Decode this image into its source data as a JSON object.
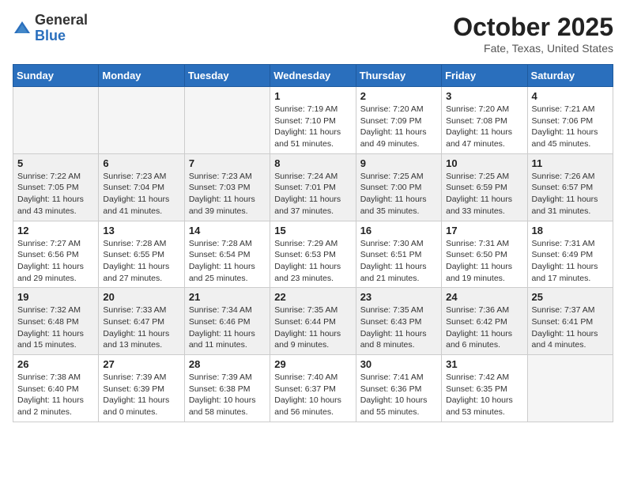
{
  "header": {
    "logo_general": "General",
    "logo_blue": "Blue",
    "month_title": "October 2025",
    "location": "Fate, Texas, United States"
  },
  "weekdays": [
    "Sunday",
    "Monday",
    "Tuesday",
    "Wednesday",
    "Thursday",
    "Friday",
    "Saturday"
  ],
  "weeks": [
    [
      {
        "day": "",
        "sunrise": "",
        "sunset": "",
        "daylight": "",
        "empty": true
      },
      {
        "day": "",
        "sunrise": "",
        "sunset": "",
        "daylight": "",
        "empty": true
      },
      {
        "day": "",
        "sunrise": "",
        "sunset": "",
        "daylight": "",
        "empty": true
      },
      {
        "day": "1",
        "sunrise": "Sunrise: 7:19 AM",
        "sunset": "Sunset: 7:10 PM",
        "daylight": "Daylight: 11 hours and 51 minutes."
      },
      {
        "day": "2",
        "sunrise": "Sunrise: 7:20 AM",
        "sunset": "Sunset: 7:09 PM",
        "daylight": "Daylight: 11 hours and 49 minutes."
      },
      {
        "day": "3",
        "sunrise": "Sunrise: 7:20 AM",
        "sunset": "Sunset: 7:08 PM",
        "daylight": "Daylight: 11 hours and 47 minutes."
      },
      {
        "day": "4",
        "sunrise": "Sunrise: 7:21 AM",
        "sunset": "Sunset: 7:06 PM",
        "daylight": "Daylight: 11 hours and 45 minutes."
      }
    ],
    [
      {
        "day": "5",
        "sunrise": "Sunrise: 7:22 AM",
        "sunset": "Sunset: 7:05 PM",
        "daylight": "Daylight: 11 hours and 43 minutes."
      },
      {
        "day": "6",
        "sunrise": "Sunrise: 7:23 AM",
        "sunset": "Sunset: 7:04 PM",
        "daylight": "Daylight: 11 hours and 41 minutes."
      },
      {
        "day": "7",
        "sunrise": "Sunrise: 7:23 AM",
        "sunset": "Sunset: 7:03 PM",
        "daylight": "Daylight: 11 hours and 39 minutes."
      },
      {
        "day": "8",
        "sunrise": "Sunrise: 7:24 AM",
        "sunset": "Sunset: 7:01 PM",
        "daylight": "Daylight: 11 hours and 37 minutes."
      },
      {
        "day": "9",
        "sunrise": "Sunrise: 7:25 AM",
        "sunset": "Sunset: 7:00 PM",
        "daylight": "Daylight: 11 hours and 35 minutes."
      },
      {
        "day": "10",
        "sunrise": "Sunrise: 7:25 AM",
        "sunset": "Sunset: 6:59 PM",
        "daylight": "Daylight: 11 hours and 33 minutes."
      },
      {
        "day": "11",
        "sunrise": "Sunrise: 7:26 AM",
        "sunset": "Sunset: 6:57 PM",
        "daylight": "Daylight: 11 hours and 31 minutes."
      }
    ],
    [
      {
        "day": "12",
        "sunrise": "Sunrise: 7:27 AM",
        "sunset": "Sunset: 6:56 PM",
        "daylight": "Daylight: 11 hours and 29 minutes."
      },
      {
        "day": "13",
        "sunrise": "Sunrise: 7:28 AM",
        "sunset": "Sunset: 6:55 PM",
        "daylight": "Daylight: 11 hours and 27 minutes."
      },
      {
        "day": "14",
        "sunrise": "Sunrise: 7:28 AM",
        "sunset": "Sunset: 6:54 PM",
        "daylight": "Daylight: 11 hours and 25 minutes."
      },
      {
        "day": "15",
        "sunrise": "Sunrise: 7:29 AM",
        "sunset": "Sunset: 6:53 PM",
        "daylight": "Daylight: 11 hours and 23 minutes."
      },
      {
        "day": "16",
        "sunrise": "Sunrise: 7:30 AM",
        "sunset": "Sunset: 6:51 PM",
        "daylight": "Daylight: 11 hours and 21 minutes."
      },
      {
        "day": "17",
        "sunrise": "Sunrise: 7:31 AM",
        "sunset": "Sunset: 6:50 PM",
        "daylight": "Daylight: 11 hours and 19 minutes."
      },
      {
        "day": "18",
        "sunrise": "Sunrise: 7:31 AM",
        "sunset": "Sunset: 6:49 PM",
        "daylight": "Daylight: 11 hours and 17 minutes."
      }
    ],
    [
      {
        "day": "19",
        "sunrise": "Sunrise: 7:32 AM",
        "sunset": "Sunset: 6:48 PM",
        "daylight": "Daylight: 11 hours and 15 minutes."
      },
      {
        "day": "20",
        "sunrise": "Sunrise: 7:33 AM",
        "sunset": "Sunset: 6:47 PM",
        "daylight": "Daylight: 11 hours and 13 minutes."
      },
      {
        "day": "21",
        "sunrise": "Sunrise: 7:34 AM",
        "sunset": "Sunset: 6:46 PM",
        "daylight": "Daylight: 11 hours and 11 minutes."
      },
      {
        "day": "22",
        "sunrise": "Sunrise: 7:35 AM",
        "sunset": "Sunset: 6:44 PM",
        "daylight": "Daylight: 11 hours and 9 minutes."
      },
      {
        "day": "23",
        "sunrise": "Sunrise: 7:35 AM",
        "sunset": "Sunset: 6:43 PM",
        "daylight": "Daylight: 11 hours and 8 minutes."
      },
      {
        "day": "24",
        "sunrise": "Sunrise: 7:36 AM",
        "sunset": "Sunset: 6:42 PM",
        "daylight": "Daylight: 11 hours and 6 minutes."
      },
      {
        "day": "25",
        "sunrise": "Sunrise: 7:37 AM",
        "sunset": "Sunset: 6:41 PM",
        "daylight": "Daylight: 11 hours and 4 minutes."
      }
    ],
    [
      {
        "day": "26",
        "sunrise": "Sunrise: 7:38 AM",
        "sunset": "Sunset: 6:40 PM",
        "daylight": "Daylight: 11 hours and 2 minutes."
      },
      {
        "day": "27",
        "sunrise": "Sunrise: 7:39 AM",
        "sunset": "Sunset: 6:39 PM",
        "daylight": "Daylight: 11 hours and 0 minutes."
      },
      {
        "day": "28",
        "sunrise": "Sunrise: 7:39 AM",
        "sunset": "Sunset: 6:38 PM",
        "daylight": "Daylight: 10 hours and 58 minutes."
      },
      {
        "day": "29",
        "sunrise": "Sunrise: 7:40 AM",
        "sunset": "Sunset: 6:37 PM",
        "daylight": "Daylight: 10 hours and 56 minutes."
      },
      {
        "day": "30",
        "sunrise": "Sunrise: 7:41 AM",
        "sunset": "Sunset: 6:36 PM",
        "daylight": "Daylight: 10 hours and 55 minutes."
      },
      {
        "day": "31",
        "sunrise": "Sunrise: 7:42 AM",
        "sunset": "Sunset: 6:35 PM",
        "daylight": "Daylight: 10 hours and 53 minutes."
      },
      {
        "day": "",
        "sunrise": "",
        "sunset": "",
        "daylight": "",
        "empty": true
      }
    ]
  ]
}
